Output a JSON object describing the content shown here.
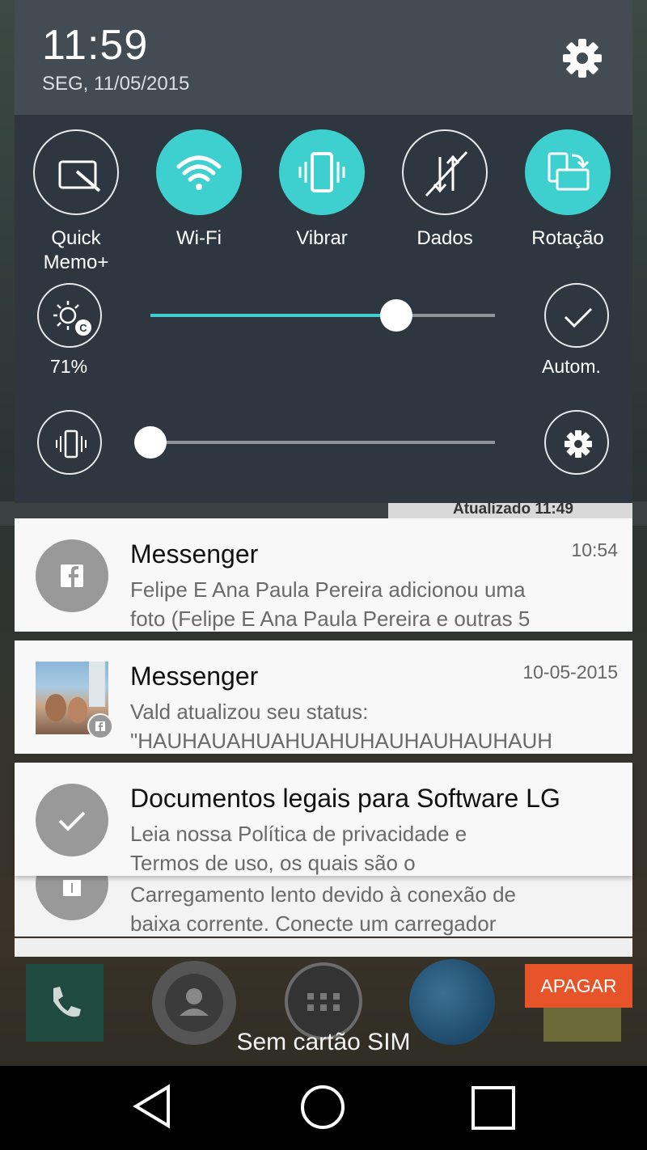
{
  "status": {
    "time": "11:59",
    "date": "SEG, 11/05/2015"
  },
  "quick_settings": {
    "toggles": [
      {
        "label": "Quick\nMemo+",
        "state": "off",
        "icon": "quickmemo-icon"
      },
      {
        "label": "Wi-Fi",
        "state": "on",
        "icon": "wifi-icon"
      },
      {
        "label": "Vibrar",
        "state": "on",
        "icon": "vibrate-icon"
      },
      {
        "label": "Dados",
        "state": "off",
        "icon": "data-icon"
      },
      {
        "label": "Rotação",
        "state": "on",
        "icon": "rotation-icon"
      }
    ],
    "brightness": {
      "percent_label": "71%",
      "auto_label": "Autom.",
      "level": 0.71
    },
    "volume": {
      "level": 0.0
    },
    "accent_color": "#3ed0cf"
  },
  "background": {
    "widget_text": "Atualizado 11:49"
  },
  "notifications": [
    {
      "app": "Messenger",
      "time": "10:54",
      "line1": "Felipe E Ana Paula Pereira adicionou uma",
      "line2": "foto (Felipe E Ana Paula Pereira e outras 5"
    },
    {
      "app": "Messenger",
      "time": "10-05-2015",
      "line1": "Vald atualizou seu status:",
      "line2": "\"HAUHAUAHUAHUAHUHAUHAUHAUHAUH"
    },
    {
      "app": "Documentos legais para Software LG",
      "time": "",
      "line1": "Leia nossa Política de privacidade e",
      "line2": "Termos de uso, os quais são o"
    },
    {
      "app": "",
      "time": "",
      "line1": "Carregamento lento devido à conexão de",
      "line2": "baixa corrente. Conecte um carregador"
    }
  ],
  "dock": {
    "clear_label": "APAGAR",
    "sim_text": "Sem cartão SIM"
  }
}
